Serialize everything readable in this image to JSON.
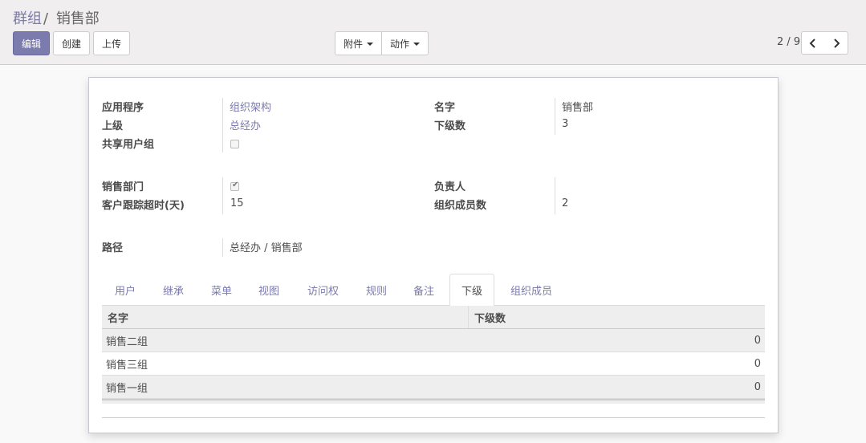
{
  "breadcrumb": {
    "parent": "群组",
    "separator": "/",
    "current": "销售部"
  },
  "buttons": {
    "edit": "编辑",
    "create": "创建",
    "upload": "上传"
  },
  "menus": {
    "attachments": "附件",
    "actions": "动作"
  },
  "pager": {
    "value": "2 / 9"
  },
  "form": {
    "application_label": "应用程序",
    "application_value": "组织架构",
    "parent_label": "上级",
    "parent_value": "总经办",
    "shared_label": "共享用户组",
    "shared_checked": false,
    "name_label": "名字",
    "name_value": "销售部",
    "children_count_label": "下级数",
    "children_count_value": "3",
    "sales_dept_label": "销售部门",
    "sales_dept_checked": true,
    "timeout_label": "客户跟踪超时(天)",
    "timeout_value": "15",
    "manager_label": "负责人",
    "manager_value": "",
    "members_count_label": "组织成员数",
    "members_count_value": "2",
    "path_label": "路径",
    "path_value": "总经办 / 销售部"
  },
  "tabs": [
    "用户",
    "继承",
    "菜单",
    "视图",
    "访问权",
    "规则",
    "备注",
    "下级",
    "组织成员"
  ],
  "active_tab": "下级",
  "table": {
    "headers": [
      "名字",
      "下级数"
    ],
    "rows": [
      {
        "name": "销售二组",
        "count": "0"
      },
      {
        "name": "销售三组",
        "count": "0"
      },
      {
        "name": "销售一组",
        "count": "0"
      }
    ]
  }
}
